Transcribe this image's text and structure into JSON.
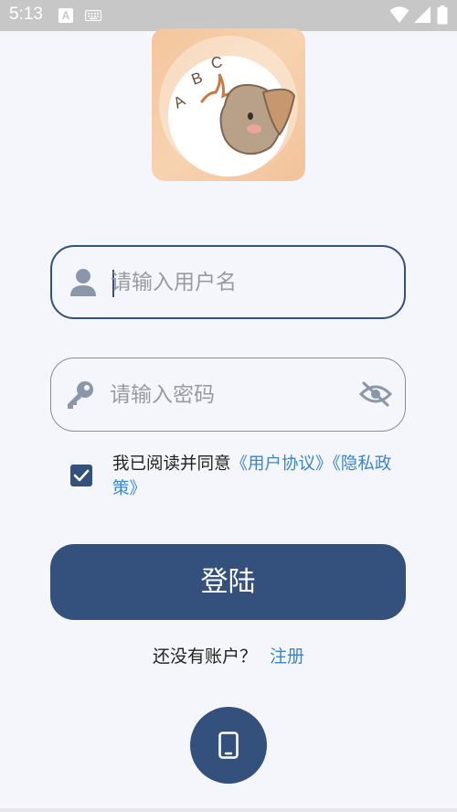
{
  "status_bar": {
    "time": "5:13",
    "a_badge": "A",
    "icons": [
      "keyboard-icon",
      "wifi-icon",
      "signal-icon",
      "battery-icon"
    ]
  },
  "logo": {
    "letters": [
      "A",
      "B",
      "C"
    ],
    "description_icon": "elephant-abc-logo"
  },
  "username": {
    "placeholder": "请输入用户名",
    "value": "",
    "icon": "user-icon"
  },
  "password": {
    "placeholder": "请输入密码",
    "value": "",
    "icon": "key-icon",
    "toggle_icon": "eye-off-icon"
  },
  "agreement": {
    "checked": true,
    "prefix": "我已阅读并同意",
    "user_agreement": "《用户协议》",
    "privacy_policy": "《隐私政策》"
  },
  "login_button": {
    "label": "登陆"
  },
  "register": {
    "prompt": "还没有账户？",
    "link": "注册"
  },
  "phone_login": {
    "icon": "smartphone-icon"
  },
  "colors": {
    "primary": "#34507D",
    "link": "#3A86C8",
    "background": "#F5F6FB",
    "status_bar": "#C7C7C7"
  }
}
